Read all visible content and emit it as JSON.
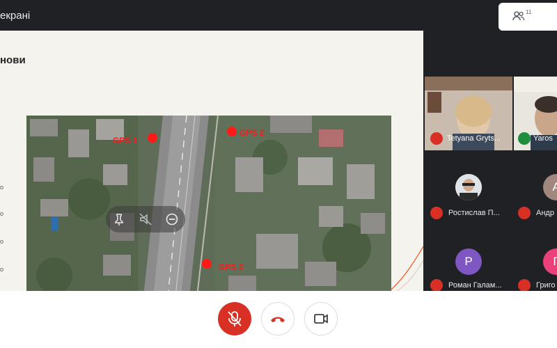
{
  "header": {
    "title": "екрані",
    "participant_count": "11",
    "icons": {
      "people": "people-icon"
    }
  },
  "slide": {
    "heading": "нови",
    "bullet_marks": [
      "о",
      "о",
      "о",
      "о",
      "о"
    ],
    "map": {
      "gps_labels": [
        "GPS 1",
        "GPS 2",
        "GPS 3"
      ],
      "overlay_icons": [
        "pin-icon",
        "mute-off-icon",
        "remove-icon"
      ]
    }
  },
  "participants": {
    "video_tiles": [
      {
        "name": "Tetyana Gryts..."
      },
      {
        "name": "Yaros"
      }
    ],
    "rows": [
      {
        "name": "Ростислав П...",
        "initial": "",
        "avatar": "photo"
      },
      {
        "name": "Андр",
        "initial": "А",
        "color": "#a1887f"
      },
      {
        "name": "Роман Галам...",
        "initial": "Р",
        "color": "#7e57c2"
      },
      {
        "name": "Григо",
        "initial": "Г",
        "color": "#ec407a"
      }
    ]
  },
  "controls": {
    "mic": "mic-off-icon",
    "hangup": "hang-up-icon",
    "camera": "camera-icon"
  },
  "colors": {
    "muted_red": "#d93025",
    "gps_red": "#ff1a1a"
  }
}
